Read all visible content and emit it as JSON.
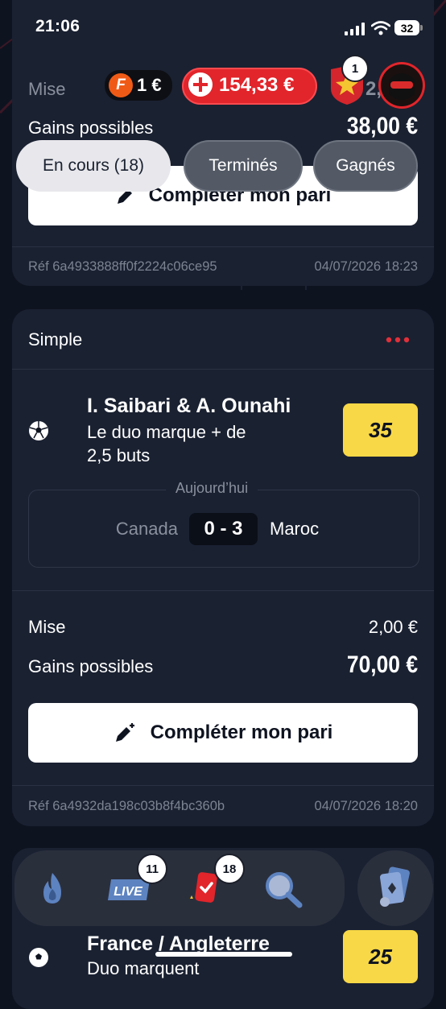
{
  "status_bar": {
    "time": "21:06",
    "battery": "32"
  },
  "header": {
    "freebet_amount": "1 €",
    "balance": "154,33 €",
    "rewards_badge": "1",
    "partial_text": "2,0"
  },
  "filters": {
    "tabs": [
      {
        "label": "En cours (18)",
        "active": true
      },
      {
        "label": "Terminés",
        "active": false
      },
      {
        "label": "Gagnés",
        "active": false
      }
    ]
  },
  "bet1": {
    "stake_label": "Mise",
    "gains_label": "Gains possibles",
    "gains_value": "38,00 €",
    "complete_label": "Compléter mon pari",
    "ref": "Réf 6a4933888ff0f2224c06ce95",
    "date": "04/07/2026 18:23"
  },
  "bet2": {
    "type": "Simple",
    "selection_title": "I. Saibari & A. Ounahi",
    "selection_line1": "Le duo marque + de",
    "selection_line2": "2,5 buts",
    "odds": "35",
    "match_day": "Aujourd’hui",
    "home_team": "Canada",
    "score": "0 - 3",
    "away_team": "Maroc",
    "stake_label": "Mise",
    "stake_value": "2,00 €",
    "gains_label": "Gains possibles",
    "gains_value": "70,00 €",
    "complete_label": "Compléter mon pari",
    "ref": "Réf 6a4932da198c03b8f4bc360b",
    "date": "04/07/2026 18:20"
  },
  "bet3": {
    "selection_title": "France / Angleterre",
    "selection_line1": "Duo marquent",
    "odds": "25"
  },
  "bottom_nav": {
    "live_label": "LIVE",
    "live_badge": "11",
    "bets_badge": "18"
  },
  "colors": {
    "background": "#0e1320",
    "card": "#1a2131",
    "accent_red": "#e1252b",
    "odds_yellow": "#f8d847",
    "menu_dots": "#e0303a"
  }
}
